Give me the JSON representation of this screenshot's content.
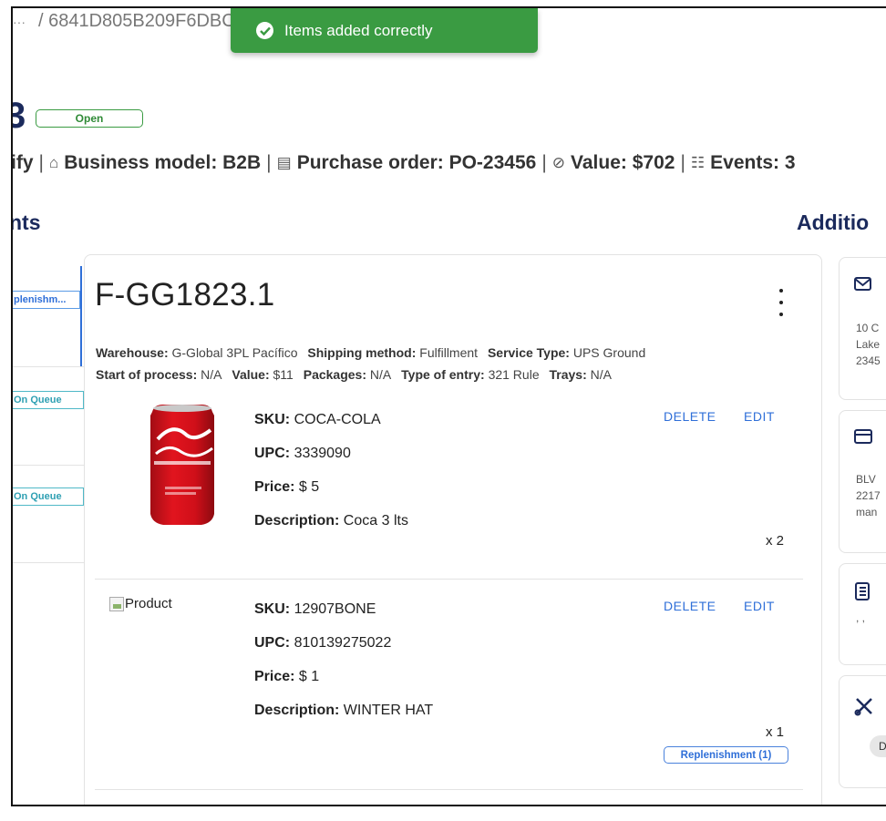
{
  "breadcrumb": {
    "dots": "···",
    "text": "/ 6841D805B209F6DBC"
  },
  "toast": {
    "message": "Items added correctly",
    "color": "#3a9b42"
  },
  "header": {
    "id_fragment": "3",
    "status": "Open",
    "meta": {
      "store_fragment": "ify",
      "business_model": "Business model: B2B",
      "purchase_order": "Purchase order: PO-23456",
      "value": "Value: $702",
      "events": "Events: 3"
    }
  },
  "sections": {
    "left_title": "nts",
    "right_title": "Additio"
  },
  "shipments": [
    {
      "tag": "plenishm...",
      "kind": "replenishment"
    },
    {
      "tag": "On Queue",
      "kind": "queue"
    },
    {
      "tag": "On Queue",
      "kind": "queue"
    }
  ],
  "fulfillment": {
    "title": "F-GG1823.1",
    "warehouse_label": "Warehouse:",
    "warehouse": "G-Global 3PL Pacífico",
    "shipping_label": "Shipping method:",
    "shipping": "Fulfillment",
    "service_label": "Service Type:",
    "service": "UPS Ground",
    "start_label": "Start of process:",
    "start": "N/A",
    "value_label": "Value:",
    "value": "$11",
    "packages_label": "Packages:",
    "packages": "N/A",
    "entry_label": "Type of entry:",
    "entry": "321 Rule",
    "trays_label": "Trays:",
    "trays": "N/A"
  },
  "items": [
    {
      "image": "coca-cola-can",
      "sku_label": "SKU:",
      "sku": "COCA-COLA",
      "upc_label": "UPC:",
      "upc": "3339090",
      "price_label": "Price:",
      "price": "$ 5",
      "desc_label": "Description:",
      "desc": "Coca 3 lts",
      "qty": "x 2",
      "delete": "DELETE",
      "edit": "EDIT"
    },
    {
      "image_alt": "Product",
      "sku_label": "SKU:",
      "sku": "12907BONE",
      "upc_label": "UPC:",
      "upc": "810139275022",
      "price_label": "Price:",
      "price": "$ 1",
      "desc_label": "Description:",
      "desc": "WINTER HAT",
      "qty": "x 1",
      "badge": "Replenishment (1)",
      "delete": "DELETE",
      "edit": "EDIT"
    }
  ],
  "right_panel": {
    "address": [
      "10 C",
      "Lake",
      "2345"
    ],
    "payment": [
      "BLV",
      "2217",
      "man"
    ],
    "notes": ", ,",
    "pill": "D"
  }
}
